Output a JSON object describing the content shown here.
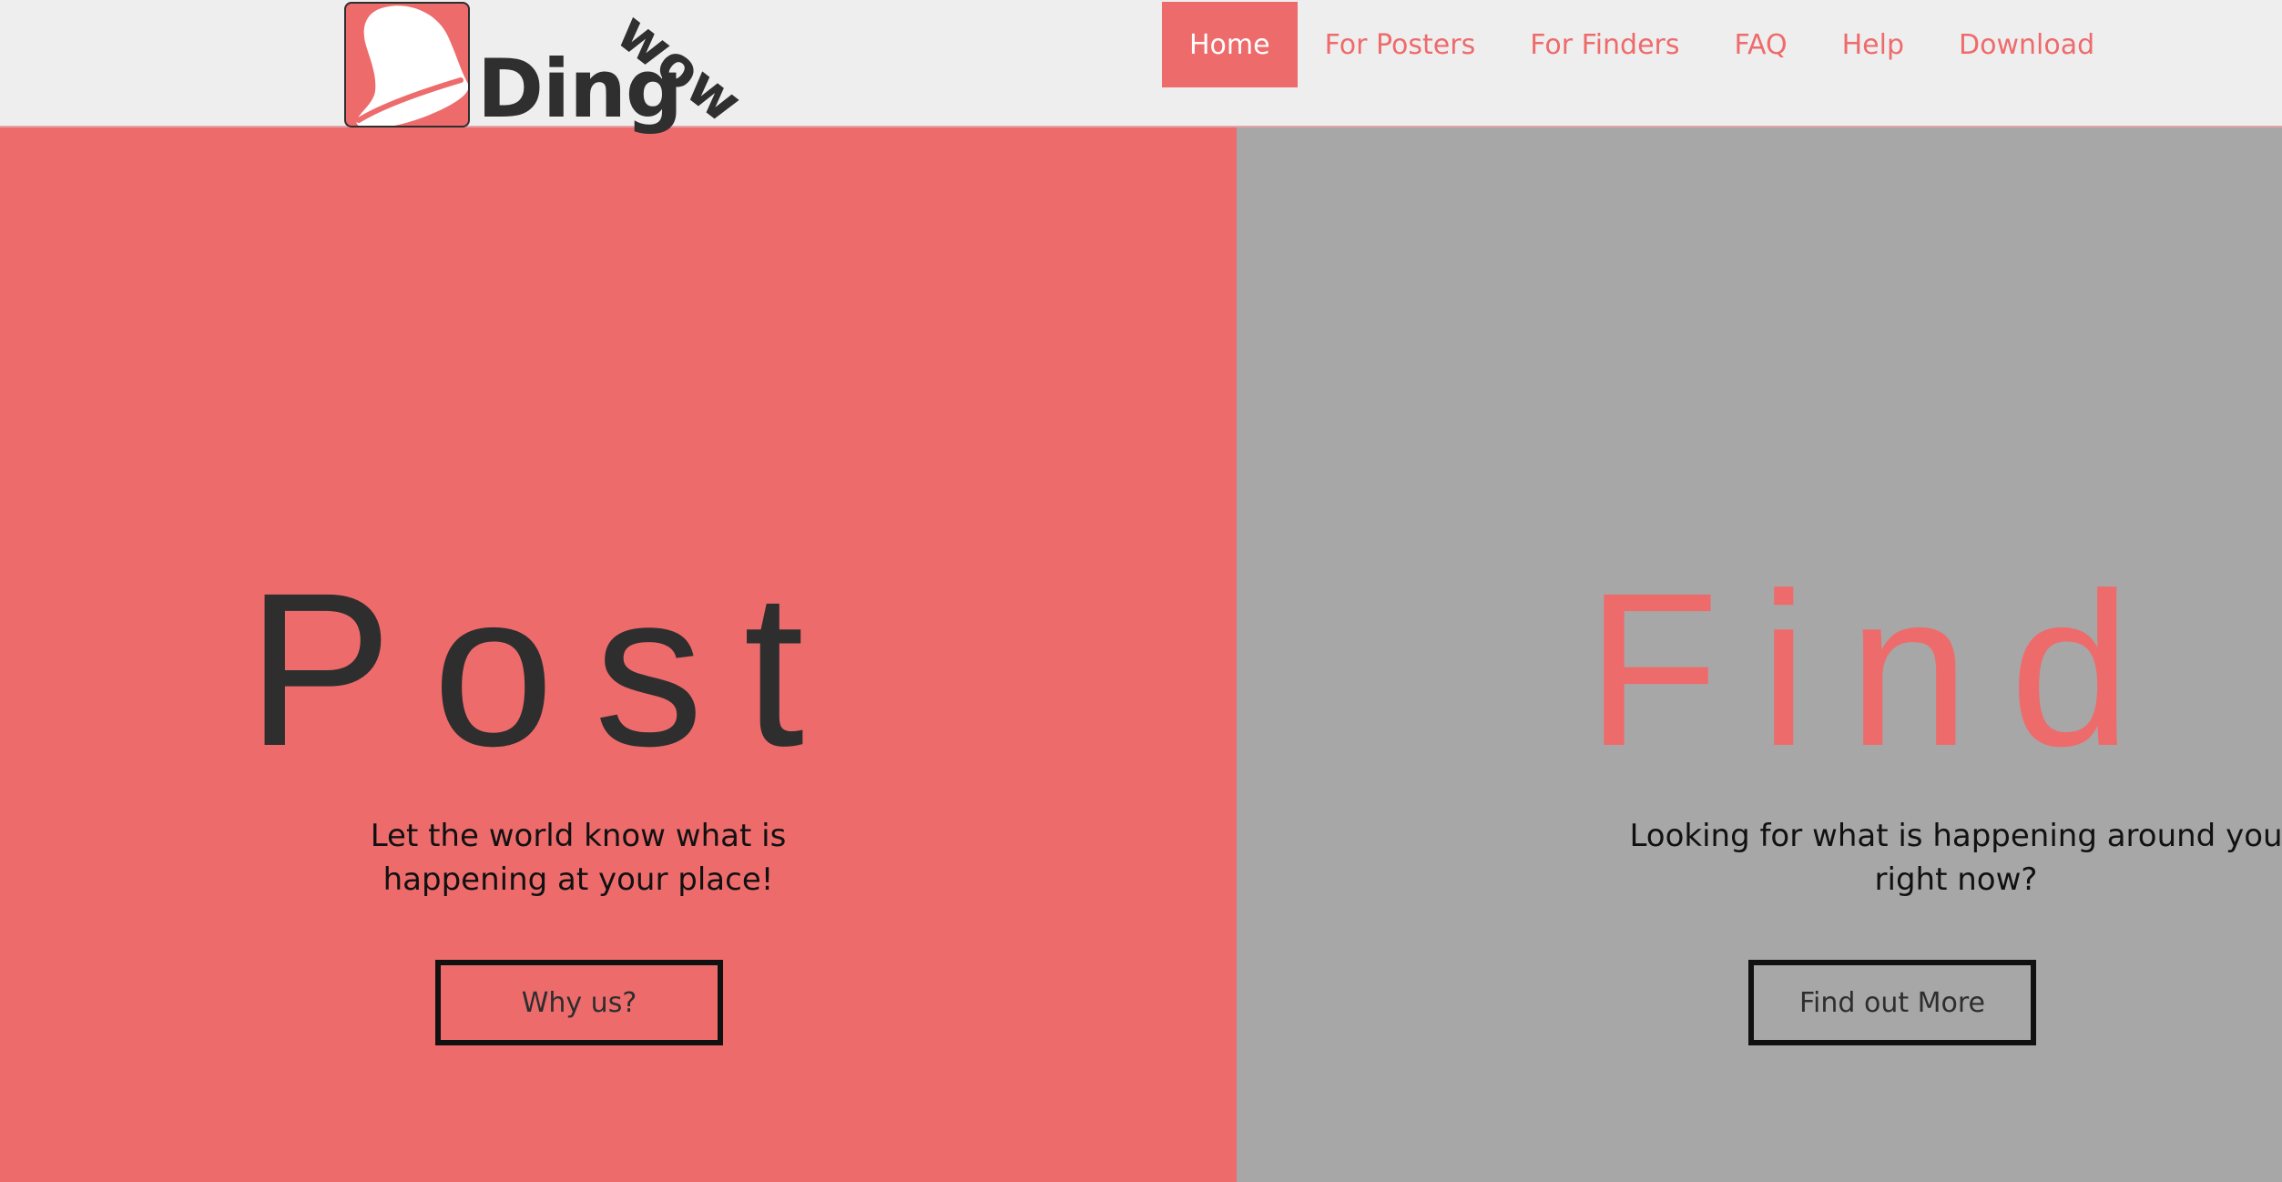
{
  "brand": {
    "name": "Ding",
    "badge": "wow",
    "logo_icon": "bell-icon"
  },
  "nav": {
    "items": [
      {
        "label": "Home",
        "active": true
      },
      {
        "label": "For Posters",
        "active": false
      },
      {
        "label": "For Finders",
        "active": false
      },
      {
        "label": "FAQ",
        "active": false
      },
      {
        "label": "Help",
        "active": false
      },
      {
        "label": "Download",
        "active": false
      }
    ]
  },
  "post": {
    "title": "Post",
    "tagline": "Let the world know what is happening at your place!",
    "button": "Why us?"
  },
  "find": {
    "title": "Find",
    "tagline": "Looking for what is happening around you right now?",
    "button": "Find out More"
  },
  "colors": {
    "accent": "#ee6b6c",
    "dark": "#2e2e2e",
    "grey_panel": "#a7a7a7",
    "header_bg": "#efeeee"
  }
}
